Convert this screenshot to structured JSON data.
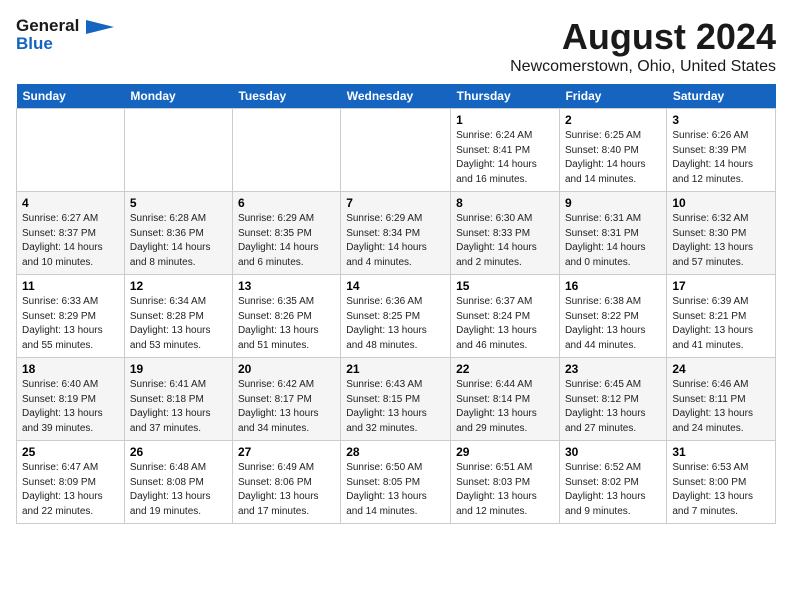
{
  "logo": {
    "line1": "General",
    "line2": "Blue"
  },
  "title": "August 2024",
  "subtitle": "Newcomerstown, Ohio, United States",
  "weekdays": [
    "Sunday",
    "Monday",
    "Tuesday",
    "Wednesday",
    "Thursday",
    "Friday",
    "Saturday"
  ],
  "weeks": [
    [
      {
        "day": "",
        "info": ""
      },
      {
        "day": "",
        "info": ""
      },
      {
        "day": "",
        "info": ""
      },
      {
        "day": "",
        "info": ""
      },
      {
        "day": "1",
        "info": "Sunrise: 6:24 AM\nSunset: 8:41 PM\nDaylight: 14 hours\nand 16 minutes."
      },
      {
        "day": "2",
        "info": "Sunrise: 6:25 AM\nSunset: 8:40 PM\nDaylight: 14 hours\nand 14 minutes."
      },
      {
        "day": "3",
        "info": "Sunrise: 6:26 AM\nSunset: 8:39 PM\nDaylight: 14 hours\nand 12 minutes."
      }
    ],
    [
      {
        "day": "4",
        "info": "Sunrise: 6:27 AM\nSunset: 8:37 PM\nDaylight: 14 hours\nand 10 minutes."
      },
      {
        "day": "5",
        "info": "Sunrise: 6:28 AM\nSunset: 8:36 PM\nDaylight: 14 hours\nand 8 minutes."
      },
      {
        "day": "6",
        "info": "Sunrise: 6:29 AM\nSunset: 8:35 PM\nDaylight: 14 hours\nand 6 minutes."
      },
      {
        "day": "7",
        "info": "Sunrise: 6:29 AM\nSunset: 8:34 PM\nDaylight: 14 hours\nand 4 minutes."
      },
      {
        "day": "8",
        "info": "Sunrise: 6:30 AM\nSunset: 8:33 PM\nDaylight: 14 hours\nand 2 minutes."
      },
      {
        "day": "9",
        "info": "Sunrise: 6:31 AM\nSunset: 8:31 PM\nDaylight: 14 hours\nand 0 minutes."
      },
      {
        "day": "10",
        "info": "Sunrise: 6:32 AM\nSunset: 8:30 PM\nDaylight: 13 hours\nand 57 minutes."
      }
    ],
    [
      {
        "day": "11",
        "info": "Sunrise: 6:33 AM\nSunset: 8:29 PM\nDaylight: 13 hours\nand 55 minutes."
      },
      {
        "day": "12",
        "info": "Sunrise: 6:34 AM\nSunset: 8:28 PM\nDaylight: 13 hours\nand 53 minutes."
      },
      {
        "day": "13",
        "info": "Sunrise: 6:35 AM\nSunset: 8:26 PM\nDaylight: 13 hours\nand 51 minutes."
      },
      {
        "day": "14",
        "info": "Sunrise: 6:36 AM\nSunset: 8:25 PM\nDaylight: 13 hours\nand 48 minutes."
      },
      {
        "day": "15",
        "info": "Sunrise: 6:37 AM\nSunset: 8:24 PM\nDaylight: 13 hours\nand 46 minutes."
      },
      {
        "day": "16",
        "info": "Sunrise: 6:38 AM\nSunset: 8:22 PM\nDaylight: 13 hours\nand 44 minutes."
      },
      {
        "day": "17",
        "info": "Sunrise: 6:39 AM\nSunset: 8:21 PM\nDaylight: 13 hours\nand 41 minutes."
      }
    ],
    [
      {
        "day": "18",
        "info": "Sunrise: 6:40 AM\nSunset: 8:19 PM\nDaylight: 13 hours\nand 39 minutes."
      },
      {
        "day": "19",
        "info": "Sunrise: 6:41 AM\nSunset: 8:18 PM\nDaylight: 13 hours\nand 37 minutes."
      },
      {
        "day": "20",
        "info": "Sunrise: 6:42 AM\nSunset: 8:17 PM\nDaylight: 13 hours\nand 34 minutes."
      },
      {
        "day": "21",
        "info": "Sunrise: 6:43 AM\nSunset: 8:15 PM\nDaylight: 13 hours\nand 32 minutes."
      },
      {
        "day": "22",
        "info": "Sunrise: 6:44 AM\nSunset: 8:14 PM\nDaylight: 13 hours\nand 29 minutes."
      },
      {
        "day": "23",
        "info": "Sunrise: 6:45 AM\nSunset: 8:12 PM\nDaylight: 13 hours\nand 27 minutes."
      },
      {
        "day": "24",
        "info": "Sunrise: 6:46 AM\nSunset: 8:11 PM\nDaylight: 13 hours\nand 24 minutes."
      }
    ],
    [
      {
        "day": "25",
        "info": "Sunrise: 6:47 AM\nSunset: 8:09 PM\nDaylight: 13 hours\nand 22 minutes."
      },
      {
        "day": "26",
        "info": "Sunrise: 6:48 AM\nSunset: 8:08 PM\nDaylight: 13 hours\nand 19 minutes."
      },
      {
        "day": "27",
        "info": "Sunrise: 6:49 AM\nSunset: 8:06 PM\nDaylight: 13 hours\nand 17 minutes."
      },
      {
        "day": "28",
        "info": "Sunrise: 6:50 AM\nSunset: 8:05 PM\nDaylight: 13 hours\nand 14 minutes."
      },
      {
        "day": "29",
        "info": "Sunrise: 6:51 AM\nSunset: 8:03 PM\nDaylight: 13 hours\nand 12 minutes."
      },
      {
        "day": "30",
        "info": "Sunrise: 6:52 AM\nSunset: 8:02 PM\nDaylight: 13 hours\nand 9 minutes."
      },
      {
        "day": "31",
        "info": "Sunrise: 6:53 AM\nSunset: 8:00 PM\nDaylight: 13 hours\nand 7 minutes."
      }
    ]
  ]
}
